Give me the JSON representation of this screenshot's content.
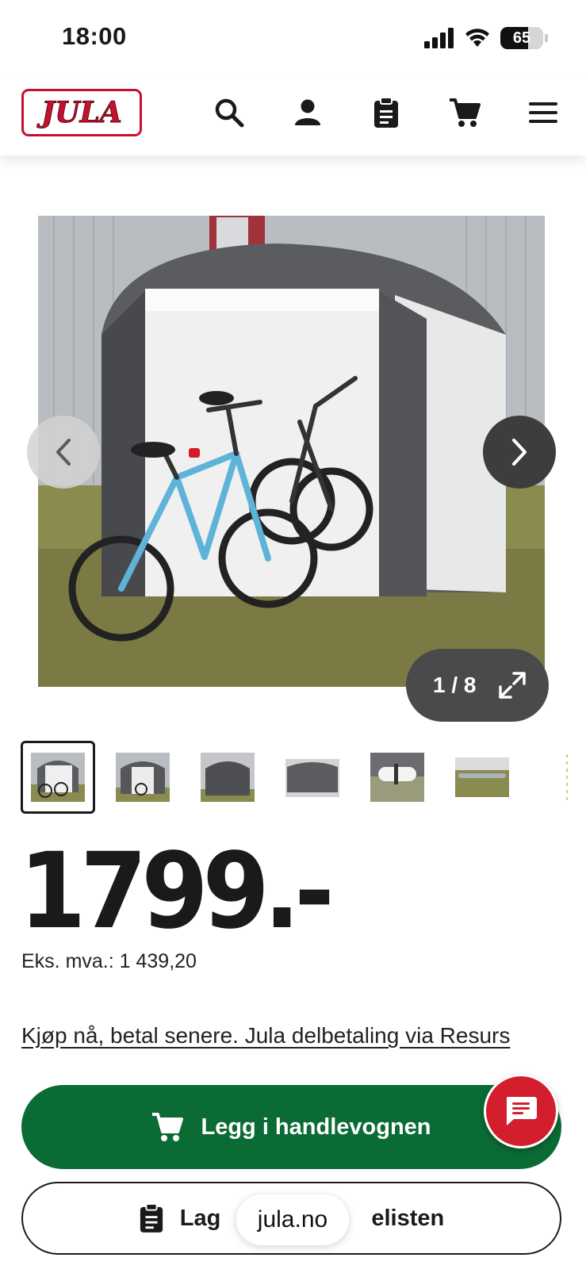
{
  "status_bar": {
    "time": "18:00",
    "battery": "65"
  },
  "header": {
    "logo_text": "JULA",
    "icons": [
      "search-icon",
      "account-icon",
      "shopping-list-icon",
      "cart-icon",
      "menu-icon"
    ]
  },
  "gallery": {
    "counter": "1 / 8",
    "current_index": 1,
    "total_images": 8
  },
  "product": {
    "price": "1799.-",
    "ex_vat": "Eks. mva.: 1 439,20",
    "finance_link": "Kjøp nå, betal senere. Jula delbetaling via Resurs"
  },
  "actions": {
    "add_to_cart": "Legg i handlevognen",
    "add_to_list_visible_start": "Lag",
    "add_to_list_visible_end": "elisten"
  },
  "browser": {
    "url": "jula.no"
  },
  "colors": {
    "brand_red": "#c8102e",
    "cart_green": "#0b6b35",
    "chat_red": "#d31f2d"
  }
}
